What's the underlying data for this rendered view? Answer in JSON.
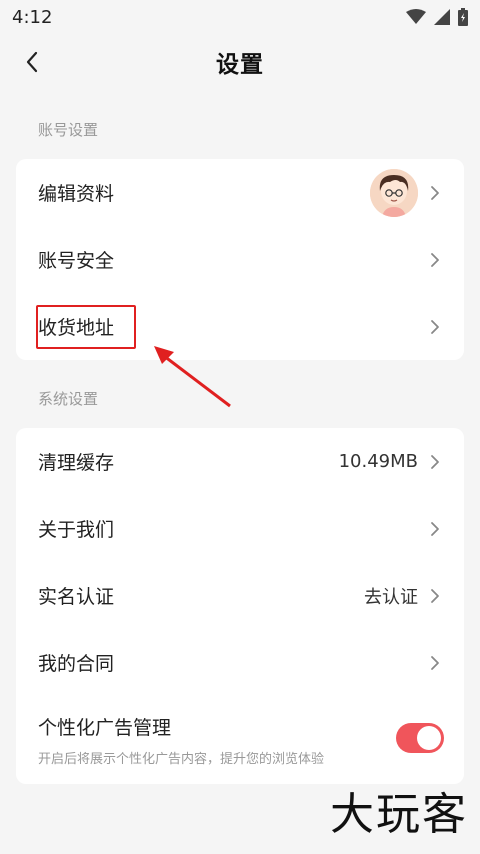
{
  "status_bar": {
    "time": "4:12",
    "icons": [
      "wifi-icon",
      "signal-icon",
      "battery-icon"
    ]
  },
  "header": {
    "title": "设置",
    "back_icon": "chevron-left-icon"
  },
  "account_section": {
    "label": "账号设置",
    "items": [
      {
        "label": "编辑资料",
        "has_avatar": true
      },
      {
        "label": "账号安全"
      },
      {
        "label": "收货地址"
      }
    ]
  },
  "system_section": {
    "label": "系统设置",
    "items": [
      {
        "label": "清理缓存",
        "value": "10.49MB"
      },
      {
        "label": "关于我们"
      },
      {
        "label": "实名认证",
        "value": "去认证"
      },
      {
        "label": "我的合同"
      }
    ],
    "ad_management": {
      "label": "个性化广告管理",
      "description": "开启后将展示个性化广告内容，提升您的浏览体验",
      "enabled": true
    }
  },
  "watermark": "大玩客",
  "colors": {
    "accent": "#f0555b",
    "annotation": "#e02020"
  }
}
